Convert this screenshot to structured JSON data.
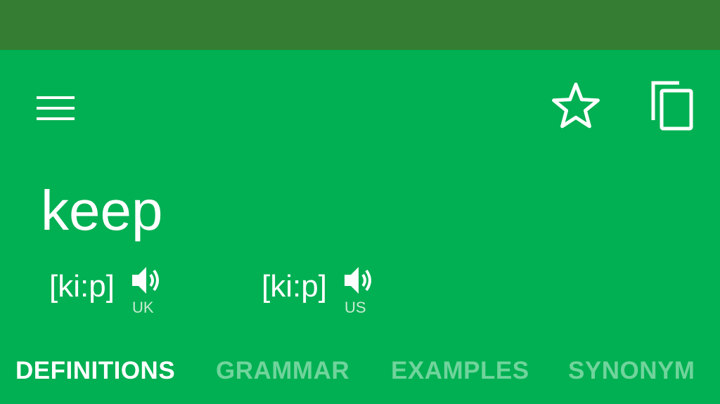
{
  "colors": {
    "status_bar": "#357d32",
    "toolbar": "#00b052",
    "text": "#ffffff",
    "inactive_tab": "#6fd49b"
  },
  "toolbar": {
    "menu_icon": "hamburger-menu-icon",
    "favorite_icon": "star-outline-icon",
    "copy_icon": "copy-icon"
  },
  "entry": {
    "word": "keep",
    "pronunciations": [
      {
        "ipa": "[ki:p]",
        "region": "UK",
        "icon": "speaker-icon"
      },
      {
        "ipa": "[ki:p]",
        "region": "US",
        "icon": "speaker-icon"
      }
    ]
  },
  "tabs": [
    {
      "label": "DEFINITIONS",
      "active": true
    },
    {
      "label": "GRAMMAR",
      "active": false
    },
    {
      "label": "EXAMPLES",
      "active": false
    },
    {
      "label": "SYNONYM",
      "active": false
    }
  ]
}
